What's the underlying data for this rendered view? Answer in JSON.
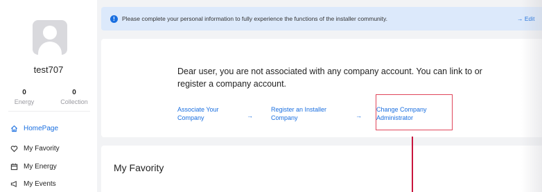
{
  "user": {
    "name": "test707",
    "energy_count": "0",
    "energy_label": "Energy",
    "collection_count": "0",
    "collection_label": "Collection"
  },
  "sidebar": {
    "items": [
      {
        "label": "HomePage",
        "icon": "home-icon",
        "active": true
      },
      {
        "label": "My Favority",
        "icon": "heart-icon",
        "active": false
      },
      {
        "label": "My Energy",
        "icon": "energy-icon",
        "active": false
      },
      {
        "label": "My Events",
        "icon": "megaphone-icon",
        "active": false
      }
    ]
  },
  "notice": {
    "text": "Please complete your personal information to fully experience the functions of the installer community.",
    "edit_label": "→ Edit"
  },
  "company": {
    "message": "Dear user, you are not associated with any company account. You can link to or register a company account.",
    "actions": [
      {
        "label": "Associate Your Company"
      },
      {
        "label": "Register an Installer Company"
      },
      {
        "label": "Change Company Administrator"
      }
    ],
    "arrow": "→"
  },
  "favority": {
    "title": "My Favority"
  },
  "colors": {
    "accent": "#1a6fe0",
    "highlight": "#e0455a",
    "pointer_line": "#c8153d"
  }
}
